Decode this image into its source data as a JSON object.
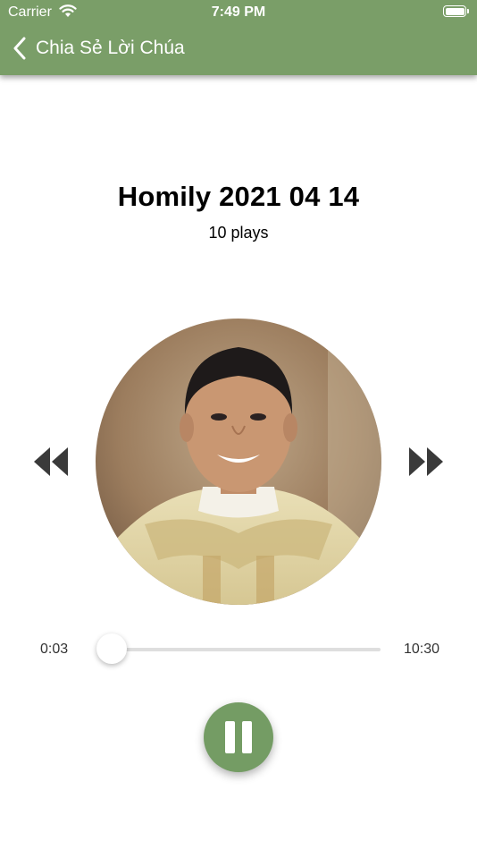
{
  "status_bar": {
    "carrier": "Carrier",
    "time": "7:49 PM"
  },
  "nav": {
    "title": "Chia Sẻ Lời Chúa",
    "back_icon": "chevron-left-icon"
  },
  "track": {
    "title": "Homily 2021 04 14",
    "plays": "10 plays"
  },
  "player": {
    "current_time": "0:03",
    "duration": "10:30",
    "progress_fraction": 0.005,
    "state": "playing"
  },
  "colors": {
    "accent": "#7a9e68",
    "play_button": "#749c64"
  }
}
